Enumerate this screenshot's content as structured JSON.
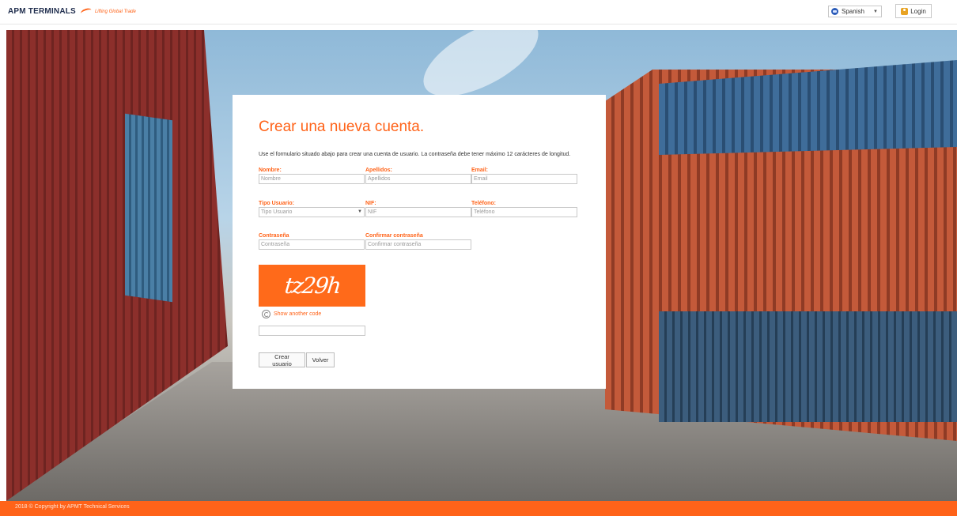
{
  "header": {
    "logo_main": "APM TERMINALS",
    "logo_tagline": "Lifting Global Trade",
    "language_selected": "Spanish",
    "login_label": "Login"
  },
  "form": {
    "title": "Crear una nueva cuenta.",
    "intro": "Use el formulario situado abajo para crear una cuenta de usuario. La contraseña debe tener máximo 12 carácteres de longitud.",
    "fields": {
      "nombre": {
        "label": "Nombre:",
        "placeholder": "Nombre"
      },
      "apellidos": {
        "label": "Apellidos:",
        "placeholder": "Apellidos"
      },
      "email": {
        "label": "Email:",
        "placeholder": "Email"
      },
      "tipo_usuario": {
        "label": "Tipo Usuario:",
        "value": "Tipo Usuario"
      },
      "nif": {
        "label": "NIF:",
        "placeholder": "NIF"
      },
      "telefono": {
        "label": "Teléfono:",
        "placeholder": "Teléfono"
      },
      "contrasena": {
        "label": "Contraseña",
        "placeholder": "Contraseña"
      },
      "confirmar": {
        "label": "Confirmar contraseña",
        "placeholder": "Confirmar contraseña"
      }
    },
    "captcha_text": "tz29h",
    "captcha_refresh_label": "Show another code",
    "create_button": "Crear usuario",
    "back_button": "Volver"
  },
  "footer": {
    "copyright": "2018 © Copyright by APMT Technical Services"
  },
  "colors": {
    "accent": "#ff6319"
  }
}
